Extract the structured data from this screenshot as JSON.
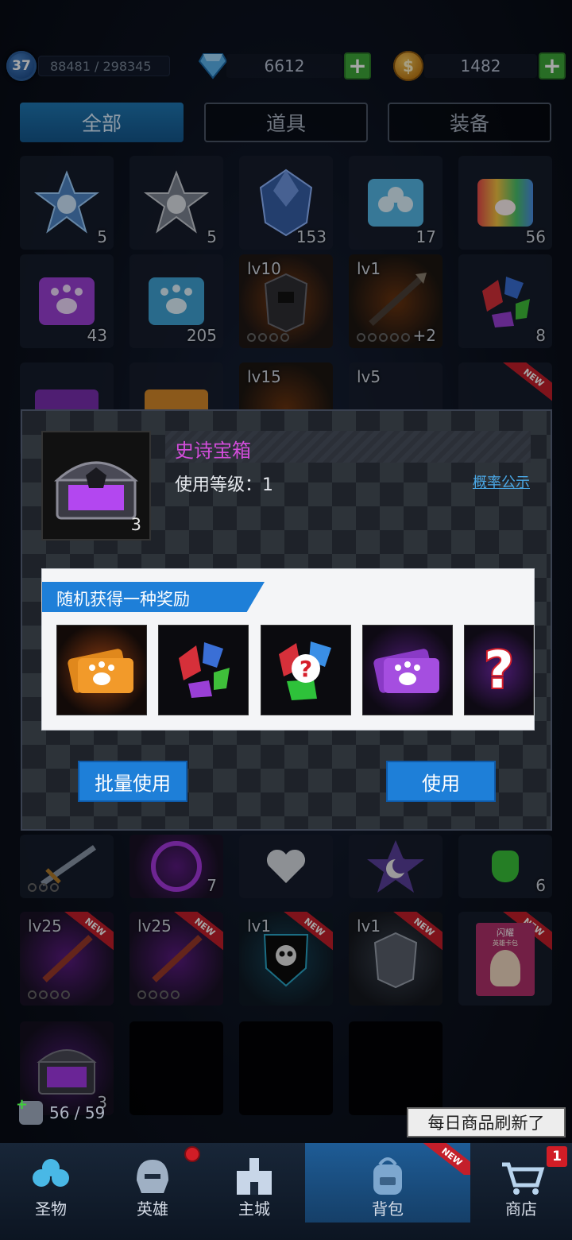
{
  "topbar": {
    "level": "37",
    "exp": "88481 / 298345",
    "diamonds": "6612",
    "coins": "1482"
  },
  "tabs": [
    {
      "label": "全部",
      "active": true
    },
    {
      "label": "道具",
      "active": false
    },
    {
      "label": "装备",
      "active": false
    }
  ],
  "grid": {
    "row1": [
      "5",
      "5",
      "153",
      "17",
      "56"
    ],
    "row2": [
      {
        "count": "43"
      },
      {
        "count": "205"
      },
      {
        "level": "lv10"
      },
      {
        "level": "lv1",
        "extra": "+2"
      },
      {
        "count": "8"
      }
    ],
    "row3": [
      {
        "level": ""
      },
      {
        "level": ""
      },
      {
        "level": "lv15"
      },
      {
        "level": "lv5"
      },
      {
        "new": "NEW"
      }
    ],
    "row4": [
      {
        "count": ""
      },
      {
        "count": "7"
      },
      {
        "count": ""
      },
      {
        "count": ""
      },
      {
        "count": "6"
      }
    ],
    "row5": [
      {
        "level": "lv25",
        "new": "NEW"
      },
      {
        "level": "lv25",
        "new": "NEW"
      },
      {
        "level": "lv1",
        "new": "NEW"
      },
      {
        "level": "lv1",
        "new": "NEW"
      },
      {
        "new": "NEW",
        "label1": "闪耀",
        "label2": "英雄卡包"
      }
    ],
    "row6": [
      {
        "count": "3"
      }
    ]
  },
  "popup": {
    "item_name": "史诗宝箱",
    "use_level": "使用等级：1",
    "probability_link": "概率公示",
    "chest_count": "3",
    "reward_title": "随机获得一种奖励",
    "batch_use_label": "批量使用",
    "use_label": "使用"
  },
  "bag": {
    "count": "56 / 59"
  },
  "daily_banner": "每日商品刷新了",
  "nav": [
    {
      "label": "圣物"
    },
    {
      "label": "英雄"
    },
    {
      "label": "主城"
    },
    {
      "label": "背包",
      "new": "NEW"
    },
    {
      "label": "商店",
      "badge": "1"
    }
  ],
  "colors": {
    "accent_blue": "#1e7fd8",
    "epic_purple": "#d34ddb",
    "plus_green": "#3ea83a",
    "badge_red": "#d11d26"
  }
}
